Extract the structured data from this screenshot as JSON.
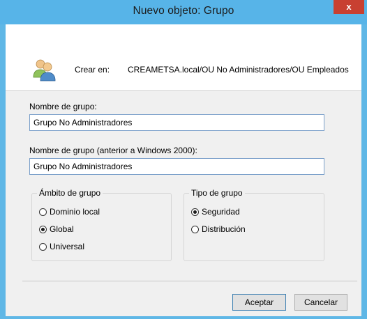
{
  "window": {
    "title": "Nuevo objeto: Grupo",
    "close_label": "x"
  },
  "header": {
    "icon": "group-users-icon",
    "create_in_label": "Crear en:",
    "create_in_path": "CREAMETSA.local/OU No Administradores/OU Empleados"
  },
  "form": {
    "group_name_label": "Nombre de grupo:",
    "group_name_value": "Grupo No Administradores",
    "pre2000_label": "Nombre de grupo (anterior a Windows 2000):",
    "pre2000_value": "Grupo No Administradores"
  },
  "scope": {
    "title": "Ámbito de grupo",
    "options": [
      {
        "label": "Dominio local",
        "selected": false
      },
      {
        "label": "Global",
        "selected": true
      },
      {
        "label": "Universal",
        "selected": false
      }
    ]
  },
  "type": {
    "title": "Tipo de grupo",
    "options": [
      {
        "label": "Seguridad",
        "selected": true
      },
      {
        "label": "Distribución",
        "selected": false
      }
    ]
  },
  "buttons": {
    "ok": "Aceptar",
    "cancel": "Cancelar"
  },
  "colors": {
    "titlebar": "#57b4e8",
    "close": "#c84031",
    "input_border": "#7a9fca"
  }
}
